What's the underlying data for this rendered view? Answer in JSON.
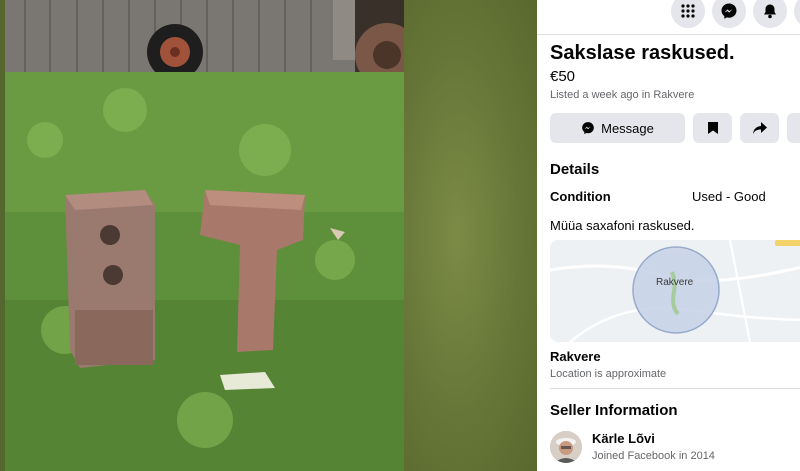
{
  "listing": {
    "title": "Sakslase raskused.",
    "price": "€50",
    "listed": "Listed a week ago in Rakvere",
    "message_label": "Message"
  },
  "details": {
    "heading": "Details",
    "condition_label": "Condition",
    "condition_value": "Used - Good",
    "description": "Müüa saxafoni raskused."
  },
  "location": {
    "map_label": "Rakvere",
    "name": "Rakvere",
    "note": "Location is approximate"
  },
  "seller": {
    "heading": "Seller Information",
    "name": "Kärle Lõvi",
    "joined": "Joined Facebook in 2014"
  },
  "icons": {
    "topbar": [
      "menu-grid-icon",
      "messenger-icon",
      "notifications-bell-icon"
    ],
    "actions": [
      "messenger-icon",
      "save-bookmark-icon",
      "share-icon"
    ]
  },
  "colors": {
    "panel_bg": "#ffffff",
    "button_bg": "#e4e6eb",
    "secondary_text": "#65676b",
    "map_circle": "#b9c6de"
  }
}
